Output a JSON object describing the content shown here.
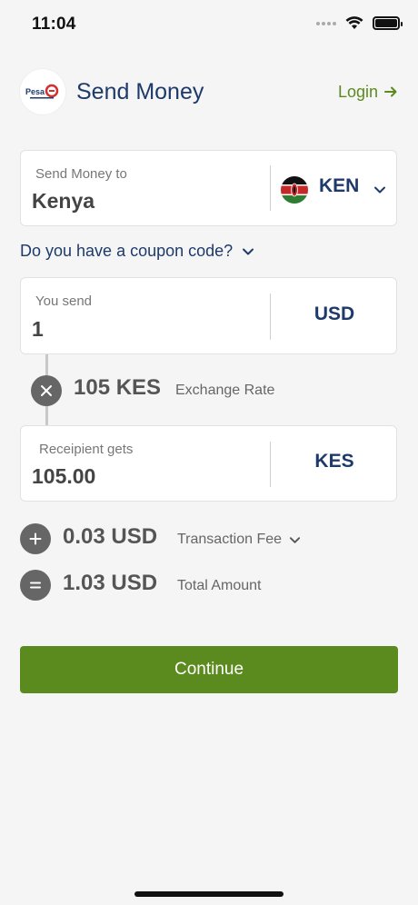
{
  "status_bar": {
    "time": "11:04"
  },
  "header": {
    "logo_text_a": "Pesa",
    "logo_text_b": "G",
    "title": "Send Money",
    "login_label": "Login"
  },
  "country": {
    "label": "Send Money to",
    "value": "Kenya",
    "code": "KEN",
    "flag": "kenya-flag"
  },
  "coupon": {
    "label": "Do you have a coupon code?"
  },
  "send": {
    "label": "You send",
    "value": "1",
    "currency": "USD"
  },
  "rate": {
    "value": "105 KES",
    "label": "Exchange Rate"
  },
  "receive": {
    "label": "Receipient gets",
    "value": "105.00",
    "currency": "KES"
  },
  "fee": {
    "value": "0.03 USD",
    "label": "Transaction Fee"
  },
  "total": {
    "value": "1.03 USD",
    "label": "Total Amount"
  },
  "continue_label": "Continue",
  "colors": {
    "brand_navy": "#1d3a6b",
    "brand_green": "#5b8a1f"
  }
}
